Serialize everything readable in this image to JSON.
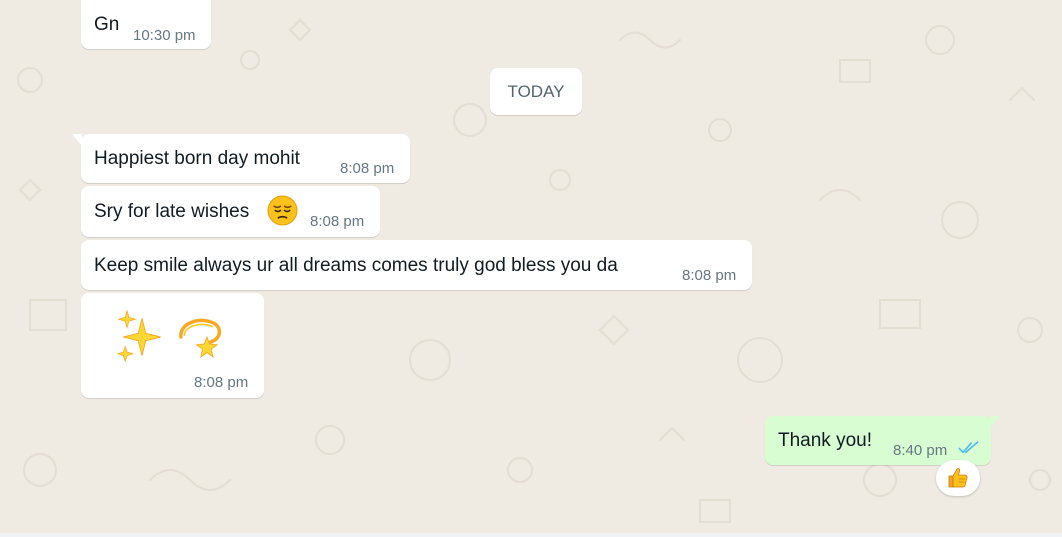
{
  "chat": {
    "date_divider": "TODAY",
    "messages": [
      {
        "direction": "in",
        "text": "Gn",
        "time": "10:30 pm"
      },
      {
        "direction": "in",
        "text": "Happiest born day mohit",
        "time": "8:08 pm"
      },
      {
        "direction": "in",
        "text": "Sry for late wishes",
        "emoji": "pensive-face",
        "time": "8:08 pm"
      },
      {
        "direction": "in",
        "text": "Keep smile always ur all dreams comes truly god bless you da",
        "time": "8:08 pm"
      },
      {
        "direction": "in",
        "emojis": [
          "sparkles",
          "dizzy"
        ],
        "time": "8:08 pm"
      },
      {
        "direction": "out",
        "text": "Thank you!",
        "time": "8:40 pm",
        "status": "read-double-check",
        "reaction": "thumbs-up"
      }
    ]
  },
  "colors": {
    "background": "#efeae2",
    "incoming_bubble": "#ffffff",
    "outgoing_bubble": "#d9fdd3",
    "read_ticks": "#53bdeb",
    "time_text": "#667781"
  }
}
